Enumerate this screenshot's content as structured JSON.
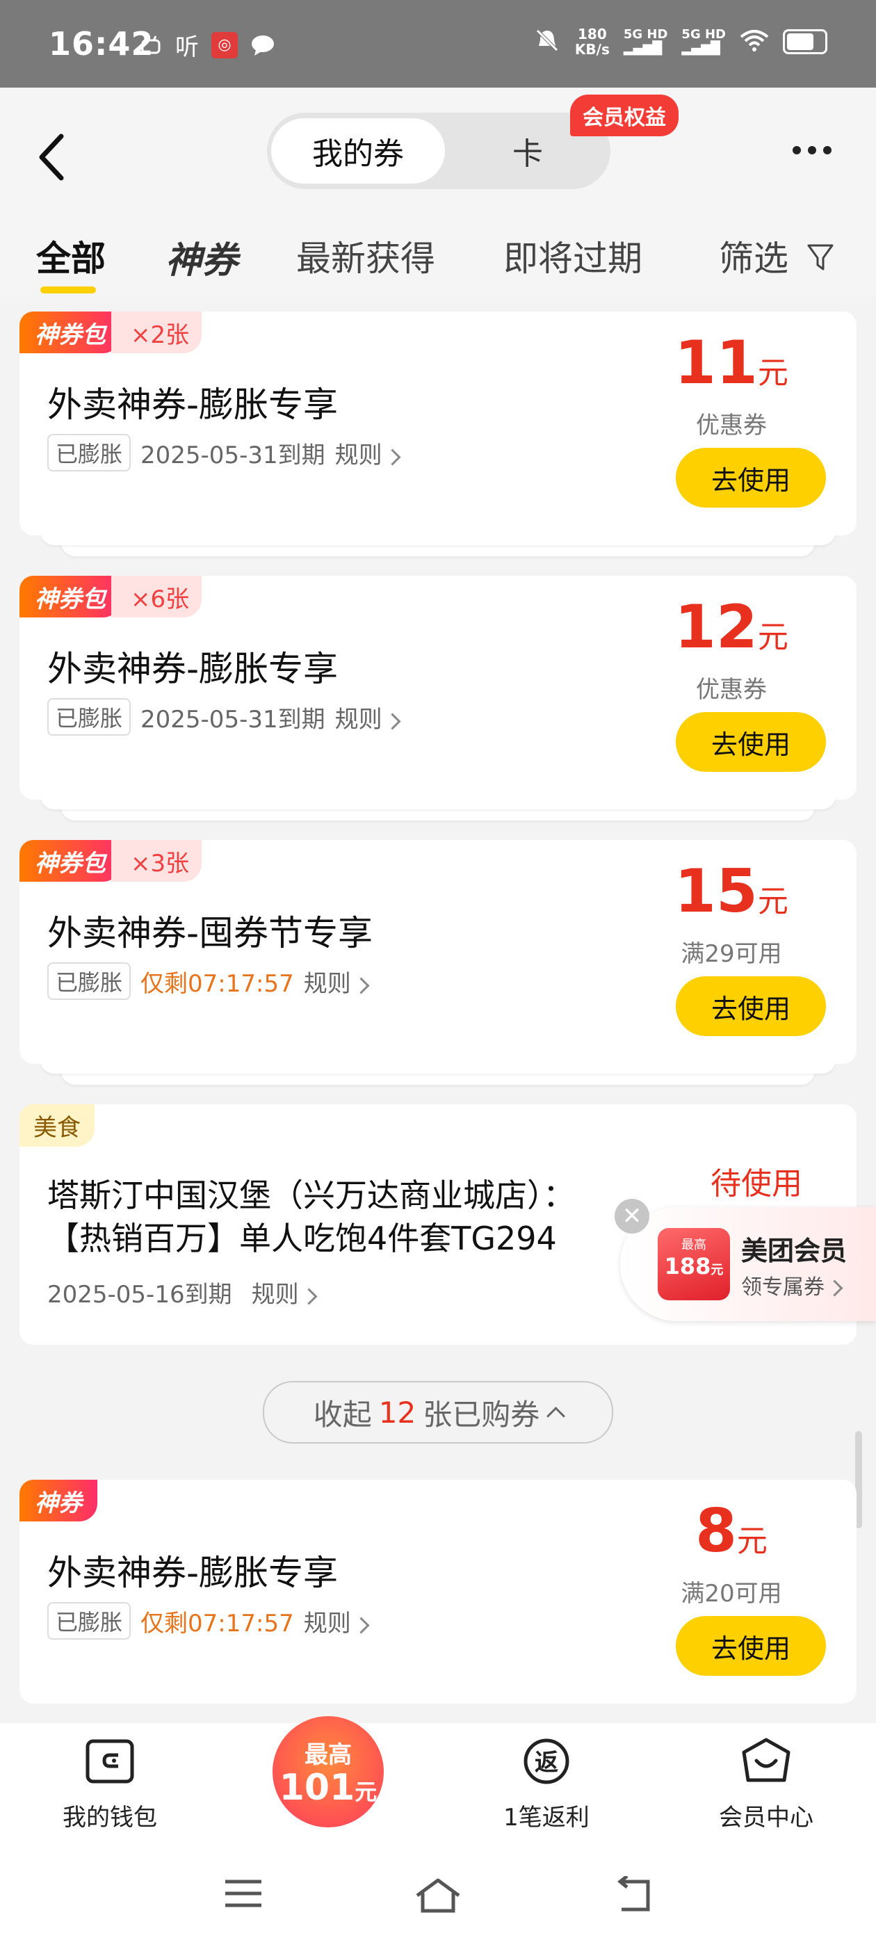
{
  "status_bar": {
    "time": "16:42",
    "left_icons": [
      "android-icon",
      "listen-icon",
      "app-icon",
      "chat-icon"
    ],
    "listen_label": "听",
    "net_speed": "180",
    "net_unit": "KB/s",
    "signal1": "5G HD",
    "signal2": "5G HD"
  },
  "header": {
    "toggle_active": "我的券",
    "toggle_inactive": "卡",
    "member_badge": "会员权益"
  },
  "tabs": [
    {
      "label": "全部"
    },
    {
      "label": "神券"
    },
    {
      "label": "最新获得"
    },
    {
      "label": "即将过期"
    },
    {
      "label": "筛选"
    }
  ],
  "coupons": [
    {
      "badge": "神券包",
      "count": "×2张",
      "title": "外卖神券-膨胀专享",
      "tag": "已膨胀",
      "expiry": "2025-05-31到期",
      "rules": "规则",
      "amount": "11",
      "unit": "元",
      "sub": "优惠券",
      "action": "去使用"
    },
    {
      "badge": "神券包",
      "count": "×6张",
      "title": "外卖神券-膨胀专享",
      "tag": "已膨胀",
      "expiry": "2025-05-31到期",
      "rules": "规则",
      "amount": "12",
      "unit": "元",
      "sub": "优惠券",
      "action": "去使用"
    },
    {
      "badge": "神券包",
      "count": "×3张",
      "title": "外卖神券-囤券节专享",
      "tag": "已膨胀",
      "expiry": "仅剩07:17:57",
      "rules": "规则",
      "amount": "15",
      "unit": "元",
      "sub": "满29可用",
      "action": "去使用"
    }
  ],
  "food_card": {
    "tag": "美食",
    "title_line1": "塔斯汀中国汉堡（兴万达商业城店）：",
    "title_line2": "【热销百万】单人吃饱4件套TG294",
    "status": "待使用",
    "expiry": "2025-05-16到期",
    "rules": "规则"
  },
  "floating_banner": {
    "card_top": "最高",
    "card_amount": "188",
    "card_unit": "元",
    "title": "美团会员",
    "subtitle": "领专属券"
  },
  "collapse": {
    "prefix": "收起",
    "count": "12",
    "suffix": "张已购券"
  },
  "last_coupon": {
    "badge": "神券",
    "title": "外卖神券-膨胀专享",
    "tag": "已膨胀",
    "expiry": "仅剩07:17:57",
    "rules": "规则",
    "amount": "8",
    "unit": "元",
    "sub": "满20可用",
    "action": "去使用"
  },
  "bottom_nav": {
    "wallet": "我的钱包",
    "promo_top": "最高",
    "promo_amount": "101",
    "promo_unit": "元",
    "rebate": "1笔返利",
    "rebate_icon_text": "返",
    "member": "会员中心"
  },
  "colors": {
    "accent_yellow": "#ffd000",
    "price_red": "#e8301e",
    "countdown_orange": "#e7741c"
  }
}
